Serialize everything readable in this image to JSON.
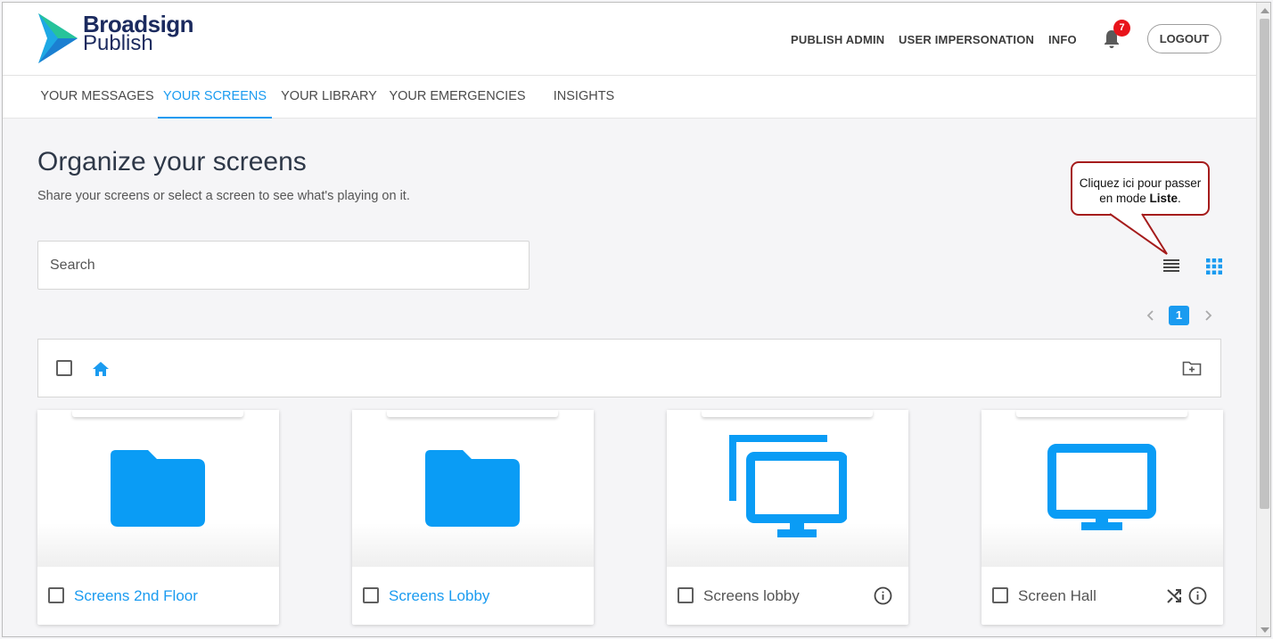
{
  "brand": {
    "line1": "Broadsign",
    "line2": "Publish"
  },
  "header": {
    "nav": [
      "PUBLISH ADMIN",
      "USER IMPERSONATION",
      "INFO"
    ],
    "notifications_count": "7",
    "logout_label": "LOGOUT"
  },
  "tabs": [
    {
      "label": "YOUR MESSAGES",
      "active": false
    },
    {
      "label": "YOUR SCREENS",
      "active": true
    },
    {
      "label": "YOUR LIBRARY",
      "active": false
    },
    {
      "label": "YOUR EMERGENCIES",
      "active": false
    },
    {
      "label": "INSIGHTS",
      "active": false
    }
  ],
  "page": {
    "title": "Organize your screens",
    "subtitle": "Share your screens or select a screen to see what's playing on it."
  },
  "search": {
    "placeholder": "Search",
    "value": ""
  },
  "callout": {
    "text_before": "Cliquez ici pour passer en mode ",
    "bold": "Liste",
    "text_after": "."
  },
  "pagination": {
    "current": "1"
  },
  "cards": [
    {
      "label": "Screens 2nd Floor",
      "type": "folder",
      "icon": "folder-icon"
    },
    {
      "label": "Screens Lobby",
      "type": "folder",
      "icon": "folder-icon"
    },
    {
      "label": "Screens lobby",
      "type": "screen-group",
      "icon": "multi-monitor-icon"
    },
    {
      "label": "Screen Hall",
      "type": "screen",
      "icon": "monitor-icon"
    }
  ],
  "colors": {
    "accent": "#1a9bf0",
    "brand_dark": "#1b2a5e",
    "badge": "#e8141b",
    "callout_border": "#a51c1c"
  }
}
